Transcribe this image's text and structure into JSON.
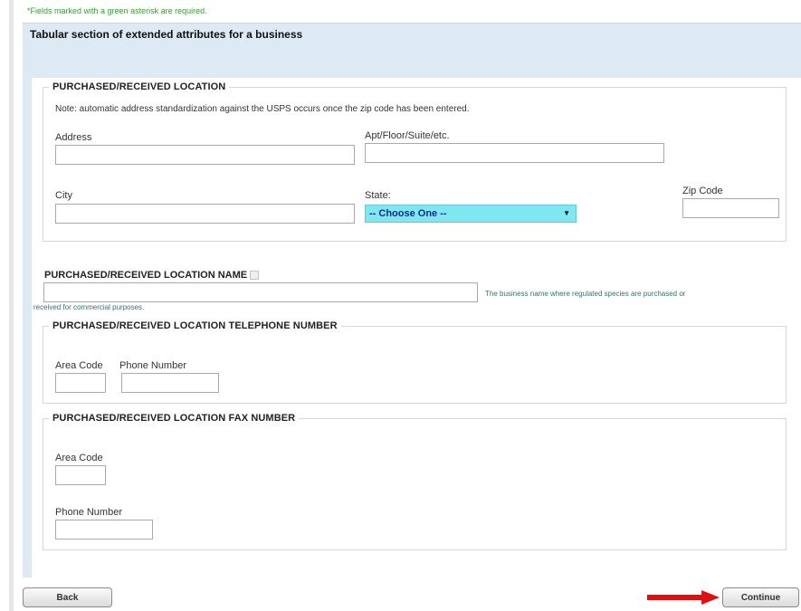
{
  "required_note": {
    "star": "*",
    "text": "Fields marked with a green asterisk are required."
  },
  "panel_title": "Tabular section of extended attributes for a business",
  "location": {
    "legend": "PURCHASED/RECEIVED LOCATION",
    "note": "Note: automatic address standardization against the USPS occurs once the zip code has been entered.",
    "address_label": "Address",
    "address_value": "",
    "apt_label": "Apt/Floor/Suite/etc.",
    "apt_value": "",
    "city_label": "City",
    "city_value": "",
    "state_label": "State:",
    "state_selected": "-- Choose One --",
    "zip_label": "Zip Code",
    "zip_value": ""
  },
  "location_name": {
    "title": "PURCHASED/RECEIVED LOCATION NAME",
    "value": "",
    "help_line1": "The business name where regulated species are purchased or",
    "help_line2": "received for commercial purposes."
  },
  "telephone": {
    "legend": "PURCHASED/RECEIVED LOCATION TELEPHONE NUMBER",
    "area_code_label": "Area Code",
    "phone_label": "Phone Number",
    "area_code_value": "",
    "phone_value": ""
  },
  "fax": {
    "legend": "PURCHASED/RECEIVED LOCATION FAX NUMBER",
    "area_code_label": "Area Code",
    "phone_label": "Phone Number",
    "area_code_value": "",
    "phone_value": ""
  },
  "buttons": {
    "back": "Back",
    "continue": "Continue"
  },
  "colors": {
    "panel_bg": "#dde9f3",
    "select_bg": "#7fe7f0",
    "required_green": "#3a9a3a",
    "arrow_red": "#e01010"
  },
  "icons": {
    "dropdown": "caret-down-icon",
    "info": "info-icon",
    "annotation": "red-arrow-icon"
  }
}
